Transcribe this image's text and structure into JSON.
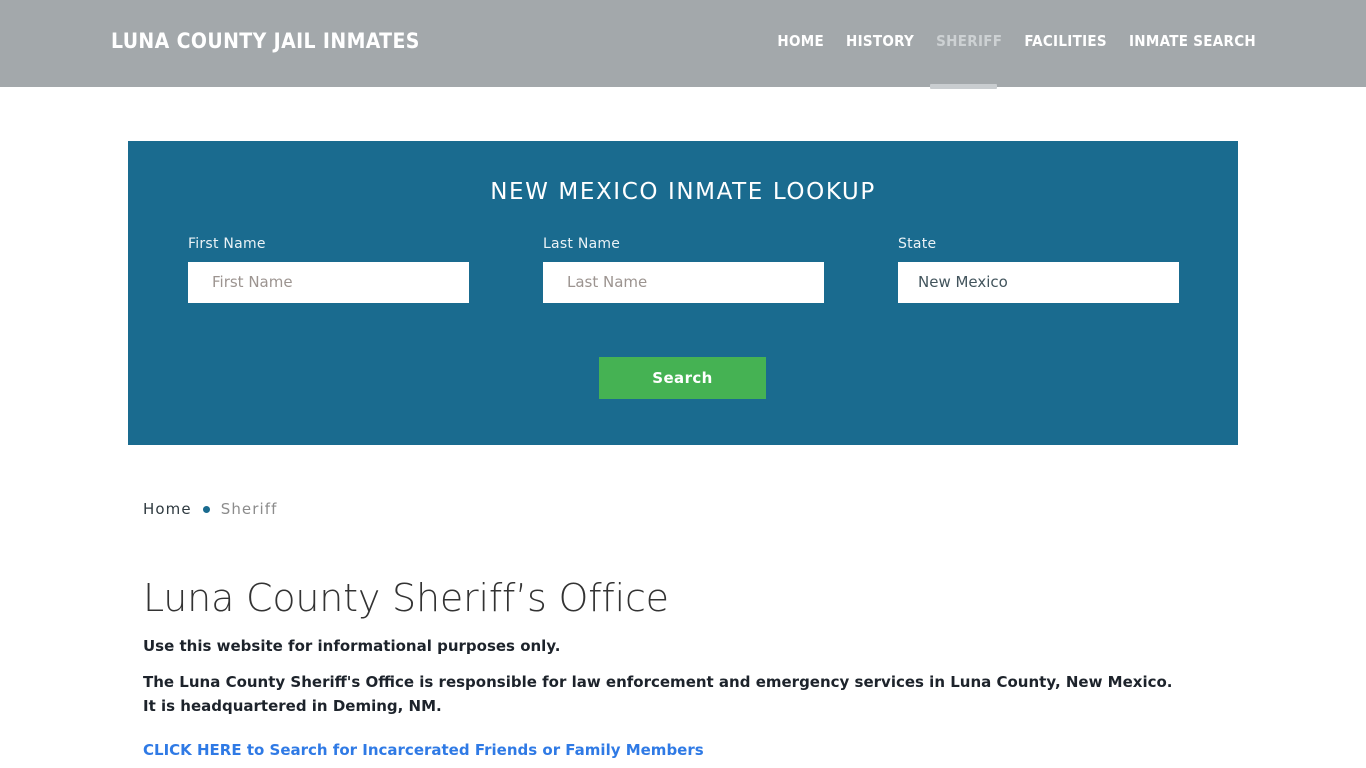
{
  "header": {
    "brand": "Luna County Jail Inmates",
    "nav": [
      {
        "label": "HOME",
        "active": false
      },
      {
        "label": "HISTORY",
        "active": false
      },
      {
        "label": "SHERIFF",
        "active": true
      },
      {
        "label": "FACILITIES",
        "active": false
      },
      {
        "label": "INMATE SEARCH",
        "active": false
      }
    ],
    "background_color": "#a3a8ab",
    "active_indicator_color": "#c9cdd0"
  },
  "lookup": {
    "title": "NEW MEXICO INMATE LOOKUP",
    "panel_color": "#1a6b8f",
    "first_name": {
      "label": "First Name",
      "placeholder": "First Name",
      "value": ""
    },
    "last_name": {
      "label": "Last Name",
      "placeholder": "Last Name",
      "value": ""
    },
    "state": {
      "label": "State",
      "selected": "New Mexico"
    },
    "search_button": {
      "label": "Search",
      "color": "#45b253"
    }
  },
  "breadcrumb": {
    "home": "Home",
    "separator": "•",
    "current": "Sheriff"
  },
  "page": {
    "title": "Luna County Sheriff’s Office",
    "lede": "Use this website for informational purposes only.",
    "paragraph": "The Luna County Sheriff's Office is responsible for law enforcement and emergency services in Luna County, New Mexico. It is headquartered in Deming, NM.",
    "cta_link": "CLICK HERE to Search for Incarcerated Friends or Family Members",
    "cta_color": "#2f7ae5"
  }
}
